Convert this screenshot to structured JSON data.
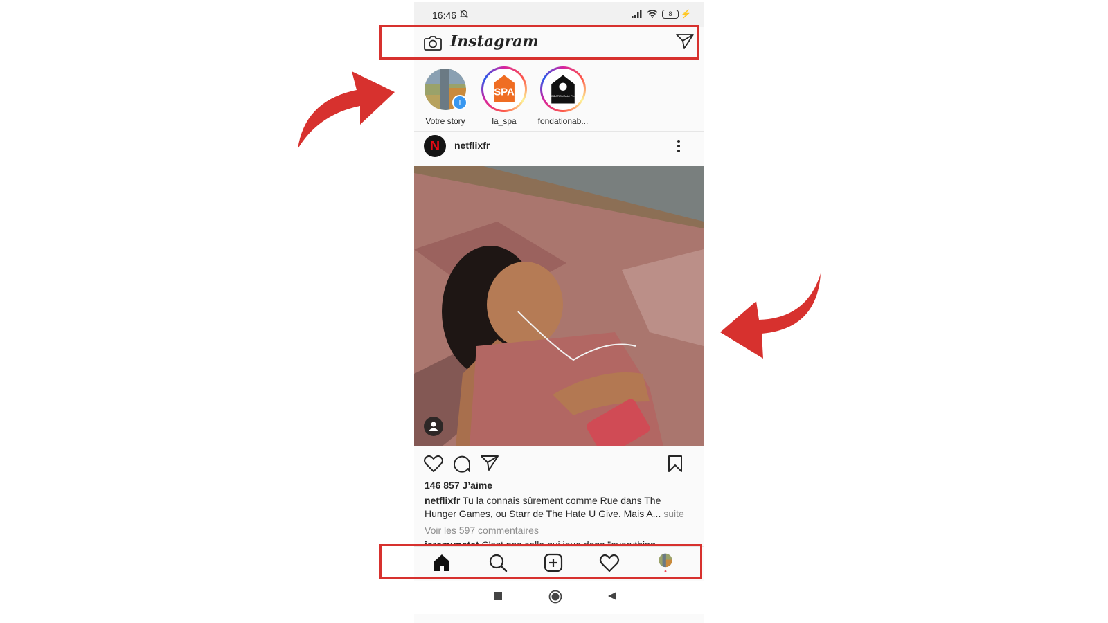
{
  "status_bar": {
    "time": "16:46",
    "battery": "8"
  },
  "header": {
    "logo": "Instagram"
  },
  "stories": [
    {
      "label": "Votre story"
    },
    {
      "label": "la_spa"
    },
    {
      "label": "fondationab..."
    }
  ],
  "post": {
    "username": "netflixfr",
    "likes": "146 857 J’aime",
    "caption_user": "netflixfr",
    "caption_text": "Tu la connais sûrement comme Rue dans The Hunger Games, ou Starr de The Hate U Give. Mais A...",
    "caption_more": "suite",
    "comments_link": "Voir les 597 commentaires",
    "comment_user": "jeremypetet",
    "comment_text": "C'est pas celle qui joue dans \"everything"
  },
  "story_avatars": {
    "spa_text": "SPA",
    "fondation_text": "FONDATION Abbé Pierre"
  },
  "colors": {
    "highlight": "#d7312e",
    "accent_blue": "#3897f0",
    "netflix_red": "#e50914"
  },
  "icons": [
    "camera-icon",
    "direct-message-icon",
    "more-icon",
    "heart-icon",
    "comment-icon",
    "share-icon",
    "bookmark-icon",
    "home-icon",
    "search-icon",
    "add-post-icon",
    "activity-icon",
    "profile-icon"
  ]
}
